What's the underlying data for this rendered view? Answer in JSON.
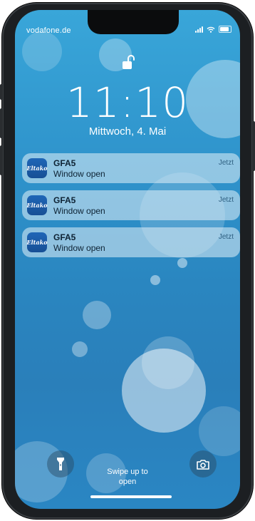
{
  "status": {
    "carrier": "vodafone.de"
  },
  "lockscreen": {
    "time": "11:10",
    "date": "Mittwoch, 4. Mai",
    "swipe_line1": "Swipe up to",
    "swipe_line2": "open"
  },
  "notifications": [
    {
      "app_icon_text": "Eltako",
      "title": "GFA5",
      "body": "Window open",
      "time": "Jetzt"
    },
    {
      "app_icon_text": "Eltako",
      "title": "GFA5",
      "body": "Window open",
      "time": "Jetzt"
    },
    {
      "app_icon_text": "Eltako",
      "title": "GFA5",
      "body": "Window open",
      "time": "Jetzt"
    }
  ],
  "icons": {
    "lock": "unlocked-padlock-icon",
    "flashlight": "flashlight-icon",
    "camera": "camera-icon"
  },
  "colors": {
    "wallpaper": "#2f94cc",
    "notification_bg": "#e4f0f7",
    "app_icon": "#1f66b7"
  }
}
